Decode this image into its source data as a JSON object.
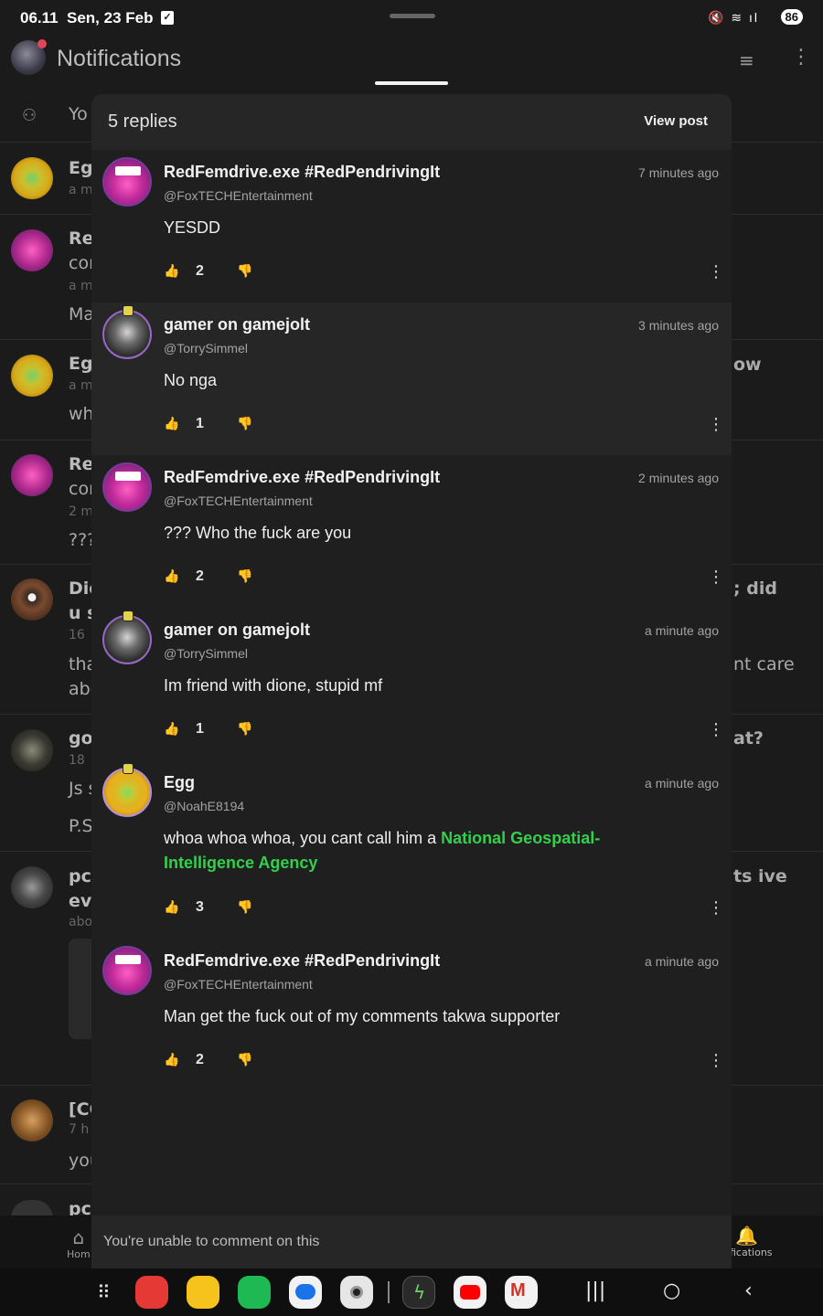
{
  "status_bar": {
    "time": "06.11",
    "date": "Sen, 23 Feb",
    "battery": "86"
  },
  "app": {
    "title": "Notifications",
    "bottom_nav": {
      "home_label": "Hom",
      "notifications_label": "fications"
    },
    "background_rows": [
      {
        "line1": "Yo"
      },
      {
        "line1": "Egg",
        "line2": "a m"
      },
      {
        "line1": "Re",
        "line2": "cor",
        "line3": "a m",
        "line4": "Ma"
      },
      {
        "line1": "Egg",
        "line2": "a m",
        "line3": "wh",
        "right": "ow"
      },
      {
        "line1": "Re",
        "line2": "cor",
        "line3": "2 m",
        "line4": "???"
      },
      {
        "line1": "Dic",
        "line2": "u s",
        "line3": "16",
        "line4": "tha",
        "line5": "abc",
        "right1": "; did",
        "right2": "nt care"
      },
      {
        "line1": "go",
        "line2": "18",
        "line3": "Js s",
        "line4": "P.S",
        "right": "at?"
      },
      {
        "line1": "pc",
        "line2": "eve",
        "line3": "abo",
        "right": "ts ive"
      },
      {
        "line1": "[CC",
        "line2": "7 h",
        "line3": "you"
      },
      {
        "line1": "pc"
      }
    ]
  },
  "modal": {
    "reply_count_label": "5 replies",
    "view_post_label": "View post",
    "footer_text": "You're unable to comment on this",
    "comments": [
      {
        "avatar": "fox-avatar",
        "name": "RedFemdrive.exe #RedPendrivingIt",
        "handle": "@FoxTECHEntertainment",
        "time": "7 minutes ago",
        "text": "YESDD",
        "likes": "2"
      },
      {
        "avatar": "gamer-avatar",
        "name": "gamer on gamejolt",
        "handle": "@TorrySimmel",
        "time": "3 minutes ago",
        "text": "No nga",
        "likes": "1"
      },
      {
        "avatar": "fox-avatar",
        "name": "RedFemdrive.exe #RedPendrivingIt",
        "handle": "@FoxTECHEntertainment",
        "time": "2 minutes ago",
        "text": "??? Who the fuck are you",
        "likes": "2"
      },
      {
        "avatar": "gamer-avatar",
        "name": "gamer on gamejolt",
        "handle": "@TorrySimmel",
        "time": "a minute ago",
        "text": "Im friend with dione, stupid mf",
        "likes": "1"
      },
      {
        "avatar": "egg-avatar",
        "name": "Egg",
        "handle": "@NoahE8194",
        "time": "a minute ago",
        "text": "whoa whoa whoa, you cant call him a ",
        "link": "National Geospatial-Intelligence Agency",
        "likes": "3"
      },
      {
        "avatar": "fox-avatar",
        "name": "RedFemdrive.exe #RedPendrivingIt",
        "handle": "@FoxTECHEntertainment",
        "time": "a minute ago",
        "text": "Man get the fuck out of my comments takwa supporter",
        "likes": "2"
      }
    ]
  },
  "colors": {
    "link_green": "#32d04b",
    "modal_bg": "#1f1f1f",
    "modal_alt_bg": "#262626"
  }
}
